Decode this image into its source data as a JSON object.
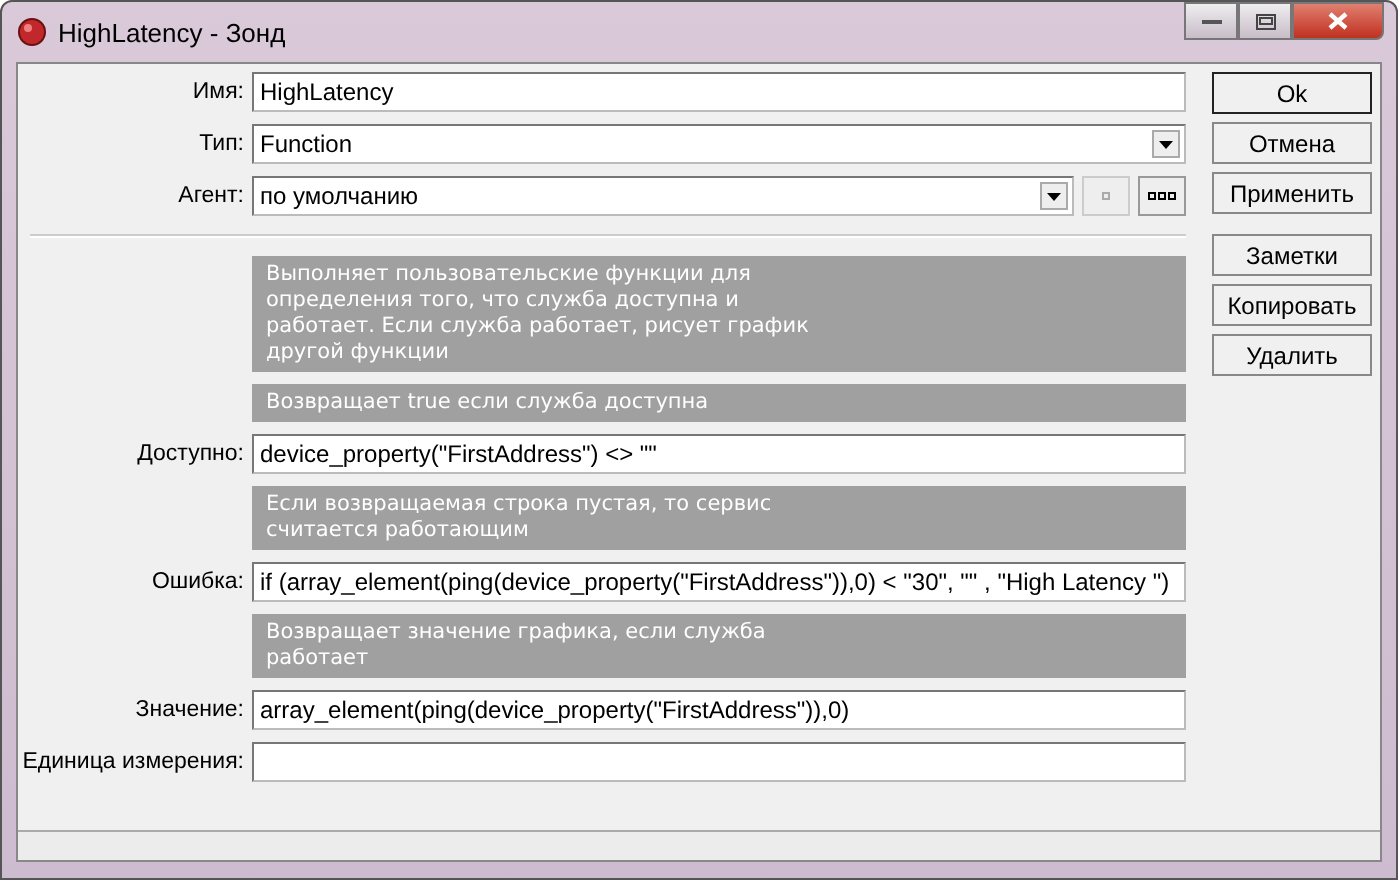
{
  "window": {
    "title": "HighLatency - Зонд"
  },
  "form": [
    {
      "kind": "field",
      "label": "Имя:",
      "value": "HighLatency"
    },
    {
      "kind": "select",
      "label": "Тип:",
      "value": "Function"
    },
    {
      "kind": "agent",
      "label": "Агент:",
      "value": "по умолчанию"
    },
    {
      "kind": "separator"
    },
    {
      "kind": "note",
      "text": "Выполняет пользовательские функции для\nопределения того, что служба доступна и\nработает. Если служба работает, рисует график\nдругой функции"
    },
    {
      "kind": "note",
      "text": "Возвращает true если служба доступна"
    },
    {
      "kind": "field",
      "label": "Доступно:",
      "value": "device_property(\"FirstAddress\") <> \"\""
    },
    {
      "kind": "note",
      "text": "Если возвращаемая строка пустая, то сервис\nсчитается работающим"
    },
    {
      "kind": "field",
      "label": "Ошибка:",
      "value": "if (array_element(ping(device_property(\"FirstAddress\")),0) < \"30\", \"\" , \"High Latency \")"
    },
    {
      "kind": "note",
      "text": "Возвращает значение графика, если служба\nработает"
    },
    {
      "kind": "field",
      "label": "Значение:",
      "value": "array_element(ping(device_property(\"FirstAddress\")),0)"
    },
    {
      "kind": "field",
      "label": "Единица измерения:"
    }
  ],
  "buttons": [
    {
      "label": "Ok",
      "default": true
    },
    {
      "label": "Отмена",
      "default": false
    },
    {
      "label": "Применить",
      "default": false
    }
  ],
  "actions": [
    {
      "label": "Заметки",
      "default": false
    },
    {
      "label": "Копировать",
      "default": false
    },
    {
      "label": "Удалить",
      "default": false
    }
  ]
}
